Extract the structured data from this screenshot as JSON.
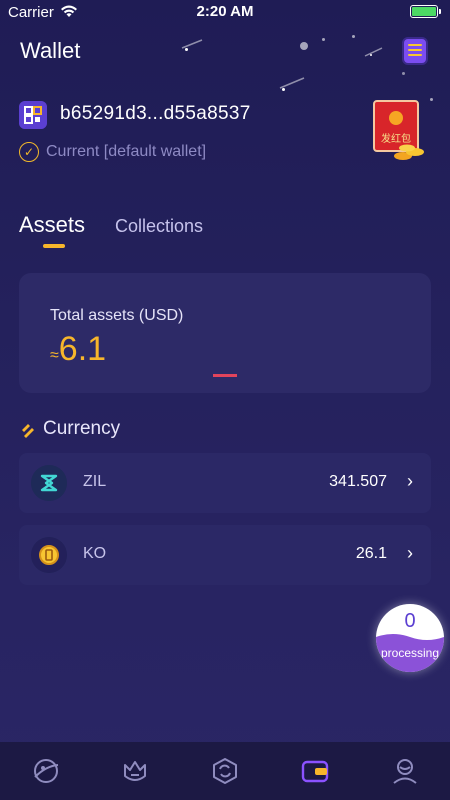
{
  "status_bar": {
    "carrier": "Carrier",
    "time": "2:20 AM"
  },
  "header": {
    "title": "Wallet",
    "menu_icon": "menu-icon"
  },
  "wallet": {
    "address": "b65291d3...d55a8537",
    "status": "Current [default wallet]",
    "red_packet_label": "发红包"
  },
  "tabs": [
    {
      "label": "Assets",
      "active": true
    },
    {
      "label": "Collections",
      "active": false
    }
  ],
  "assets_card": {
    "label": "Total assets (USD)",
    "approx": "≈",
    "value": "6.1"
  },
  "currency_section": {
    "title": "Currency",
    "items": [
      {
        "name": "ZIL",
        "amount": "341.507",
        "icon": "zil-icon"
      },
      {
        "name": "KO",
        "amount": "26.1",
        "icon": "ko-coin-icon"
      }
    ]
  },
  "processing_badge": {
    "count": "0",
    "label": "processing"
  },
  "bottom_nav": [
    {
      "icon": "explore-icon",
      "active": false
    },
    {
      "icon": "crown-icon",
      "active": false
    },
    {
      "icon": "exchange-icon",
      "active": false
    },
    {
      "icon": "wallet-icon",
      "active": true
    },
    {
      "icon": "profile-icon",
      "active": false
    }
  ],
  "colors": {
    "accent": "#f7b62b",
    "purple": "#7b4df0",
    "background": "#24215c"
  }
}
